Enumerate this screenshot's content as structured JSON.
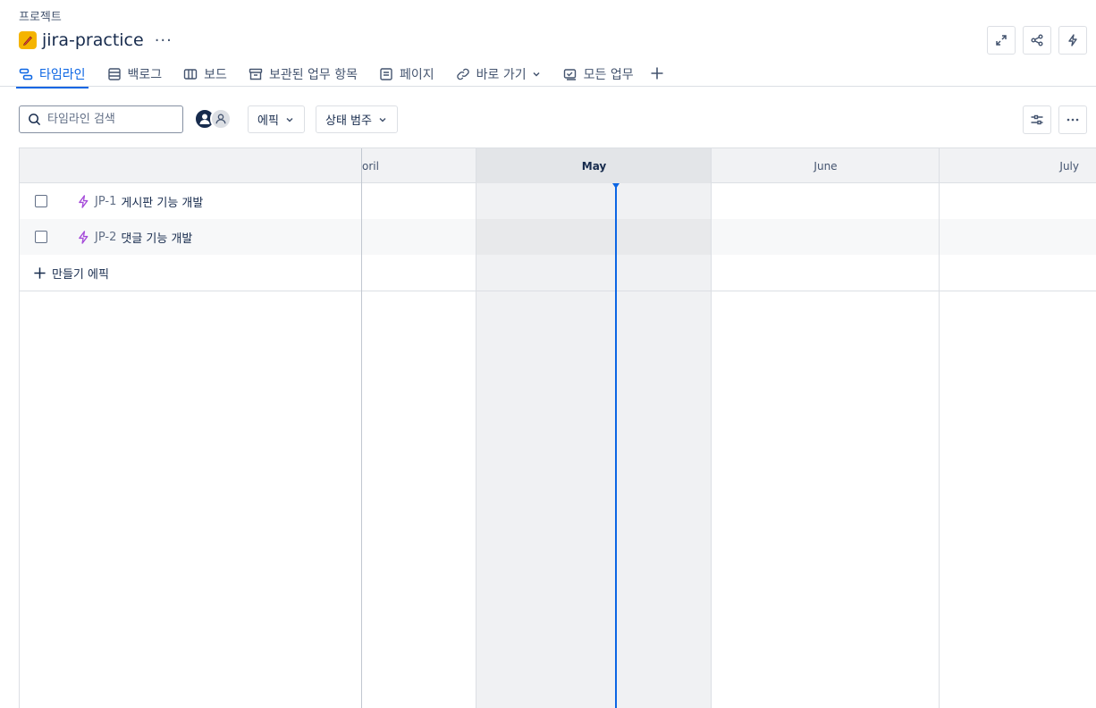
{
  "breadcrumb": "프로젝트",
  "project": {
    "title": "jira-practice",
    "more": "···"
  },
  "tabs": [
    {
      "label": "타임라인",
      "icon": "timeline-icon"
    },
    {
      "label": "백로그",
      "icon": "backlog-icon"
    },
    {
      "label": "보드",
      "icon": "board-icon"
    },
    {
      "label": "보관된 업무 항목",
      "icon": "archive-icon"
    },
    {
      "label": "페이지",
      "icon": "page-icon"
    },
    {
      "label": "바로 가기",
      "icon": "link-icon"
    },
    {
      "label": "모든 업무",
      "icon": "all-work-icon"
    }
  ],
  "search": {
    "placeholder": "타임라인 검색"
  },
  "filters": {
    "epic": "에픽",
    "status_category": "상태 범주"
  },
  "timeline": {
    "months": [
      "oril",
      "May",
      "June",
      "July"
    ],
    "current_month": "May",
    "epics": [
      {
        "key": "JP-1",
        "name": "게시판 기능 개발"
      },
      {
        "key": "JP-2",
        "name": "댓글 기능 개발"
      }
    ],
    "create_label": "만들기 에픽"
  },
  "colors": {
    "accent": "#0c66e4",
    "epic_icon": "#a54bd9",
    "project_icon": "#f5b400"
  }
}
